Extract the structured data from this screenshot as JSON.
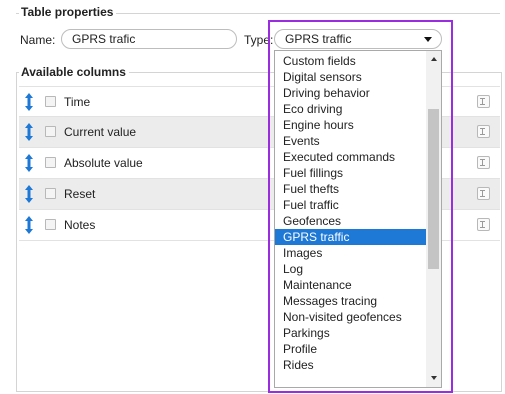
{
  "table_properties": {
    "legend": "Table properties",
    "name_label": "Name:",
    "name_value": "GPRS trafic",
    "type_label": "Type:",
    "type_value": "GPRS traffic"
  },
  "available_columns": {
    "legend": "Available columns",
    "rows": [
      {
        "label": "Time"
      },
      {
        "label": "Current value"
      },
      {
        "label": "Absolute value"
      },
      {
        "label": "Reset"
      },
      {
        "label": "Notes"
      }
    ]
  },
  "type_dropdown": {
    "options": [
      "Custom fields",
      "Digital sensors",
      "Driving behavior",
      "Eco driving",
      "Engine hours",
      "Events",
      "Executed commands",
      "Fuel fillings",
      "Fuel thefts",
      "Fuel traffic",
      "Geofences",
      "GPRS traffic",
      "Images",
      "Log",
      "Maintenance",
      "Messages tracing",
      "Non-visited geofences",
      "Parkings",
      "Profile",
      "Rides"
    ],
    "selected": "GPRS traffic"
  },
  "colors": {
    "selection": "#1e78d6",
    "drag_icon": "#1e78d6",
    "highlight_border": "#9b2de0",
    "row_alt": "#ececec"
  },
  "icons": {
    "drag": "drag-vertical-icon",
    "edit": "edit-icon",
    "select_arrow": "chevron-down-icon"
  }
}
